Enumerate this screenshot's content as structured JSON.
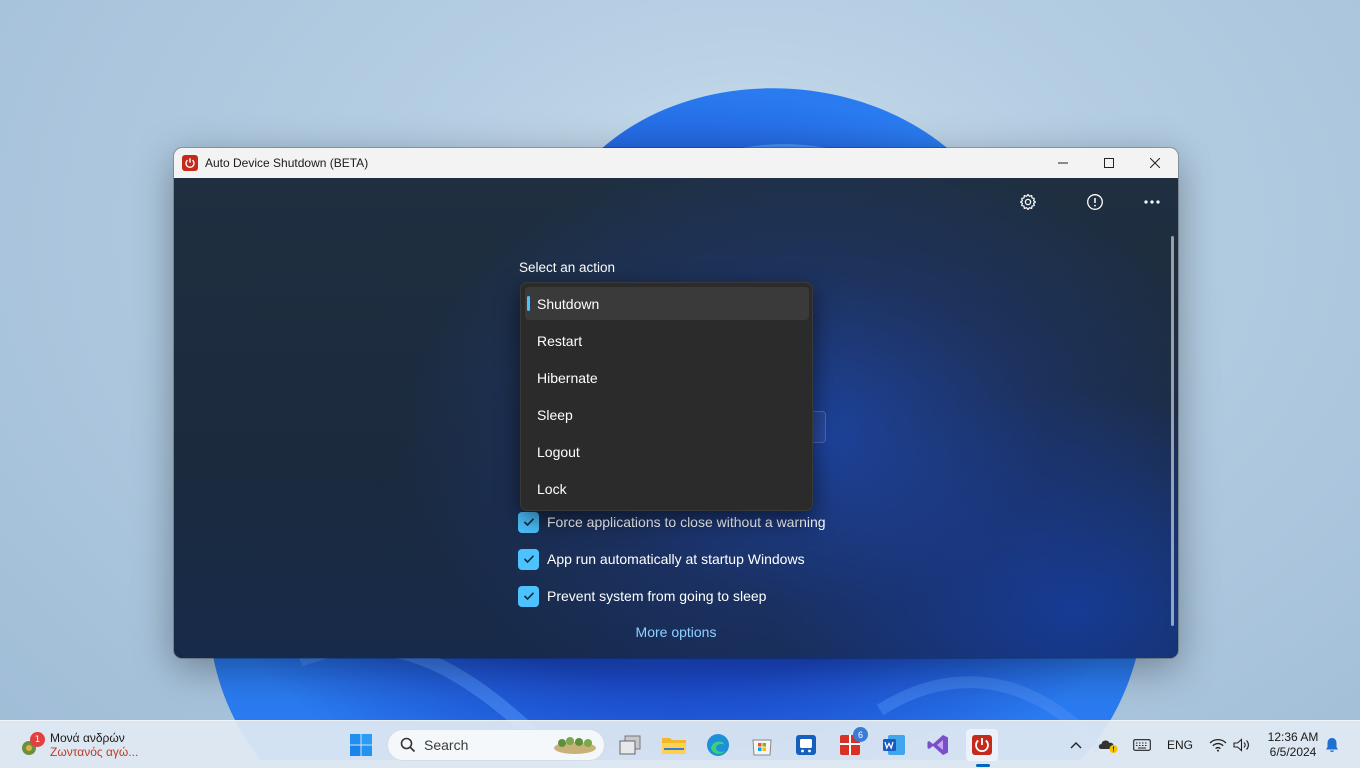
{
  "window": {
    "title": "Auto Device Shutdown (BETA)"
  },
  "main": {
    "select_action_label": "Select an action",
    "action_options": [
      "Shutdown",
      "Restart",
      "Hibernate",
      "Sleep",
      "Logout",
      "Lock"
    ],
    "selected_action": "Shutdown",
    "checkboxes": [
      {
        "label": "Force applications to close without a warning",
        "checked": true
      },
      {
        "label": "App run automatically at startup Windows",
        "checked": true
      },
      {
        "label": "Prevent system from going to sleep",
        "checked": true
      }
    ],
    "more_options": "More options"
  },
  "toolbar": {
    "icons": [
      "gear-icon",
      "info-icon",
      "more-icon"
    ]
  },
  "taskbar": {
    "weather_badge": "1",
    "weather_title": "Μονά ανδρών",
    "weather_subtitle": "Ζωντανός αγώ...",
    "search_label": "Search",
    "calendar_badge": "6",
    "language": "ENG",
    "time": "12:36 AM",
    "date": "6/5/2024"
  },
  "colors": {
    "accent": "#4cc2ff",
    "link": "#8fd0ff",
    "app_red": "#c42b1c"
  }
}
